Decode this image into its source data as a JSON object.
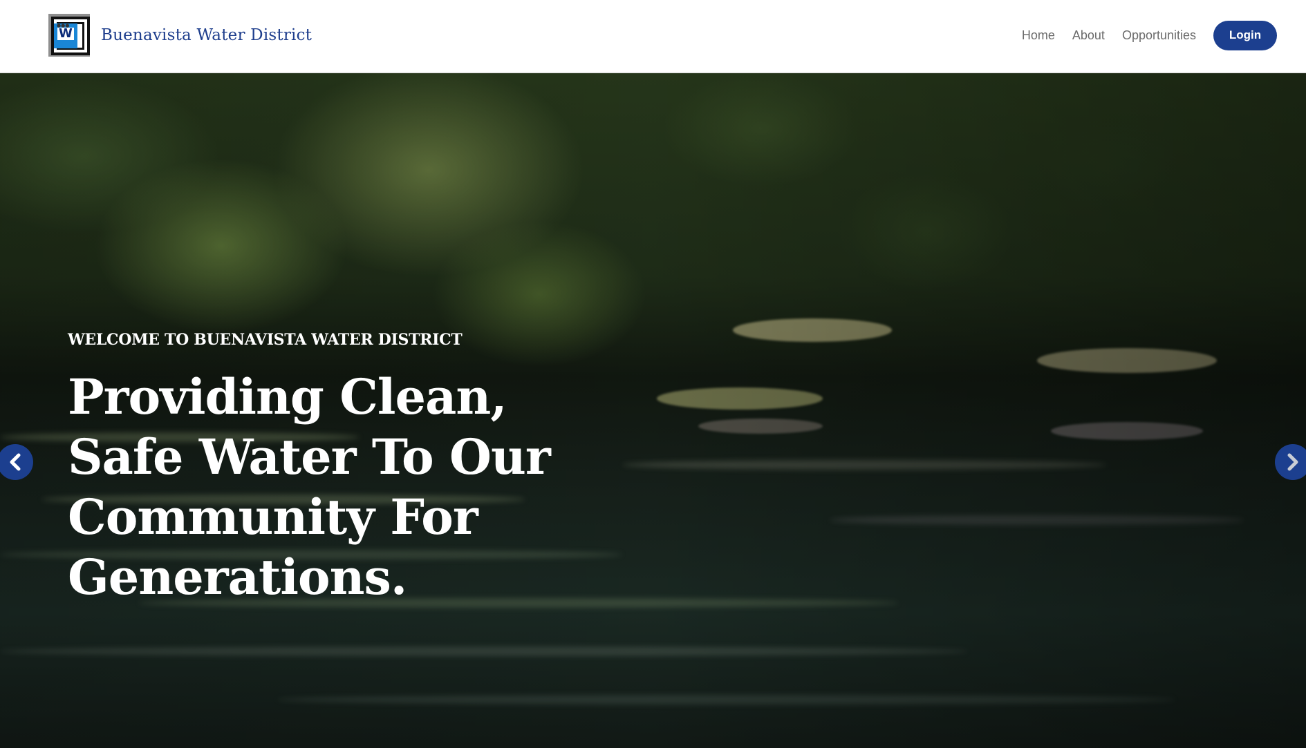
{
  "header": {
    "brand_name": "Buenavista Water District",
    "logo_icon": "water-district-logo-icon",
    "nav": {
      "items": [
        {
          "label": "Home"
        },
        {
          "label": "About"
        },
        {
          "label": "Opportunities"
        }
      ],
      "login_label": "Login"
    }
  },
  "hero": {
    "eyebrow": "WELCOME TO BUENAVISTA WATER DISTRICT",
    "title": "Providing Clean, Safe Water To Our Community For Generations.",
    "prev_icon": "chevron-left-icon",
    "next_icon": "chevron-right-icon"
  },
  "colors": {
    "brand_blue": "#1c3f8f",
    "brand_text": "#1d3d8c",
    "nav_text": "#6b6b6b",
    "hero_text": "#ffffff"
  }
}
